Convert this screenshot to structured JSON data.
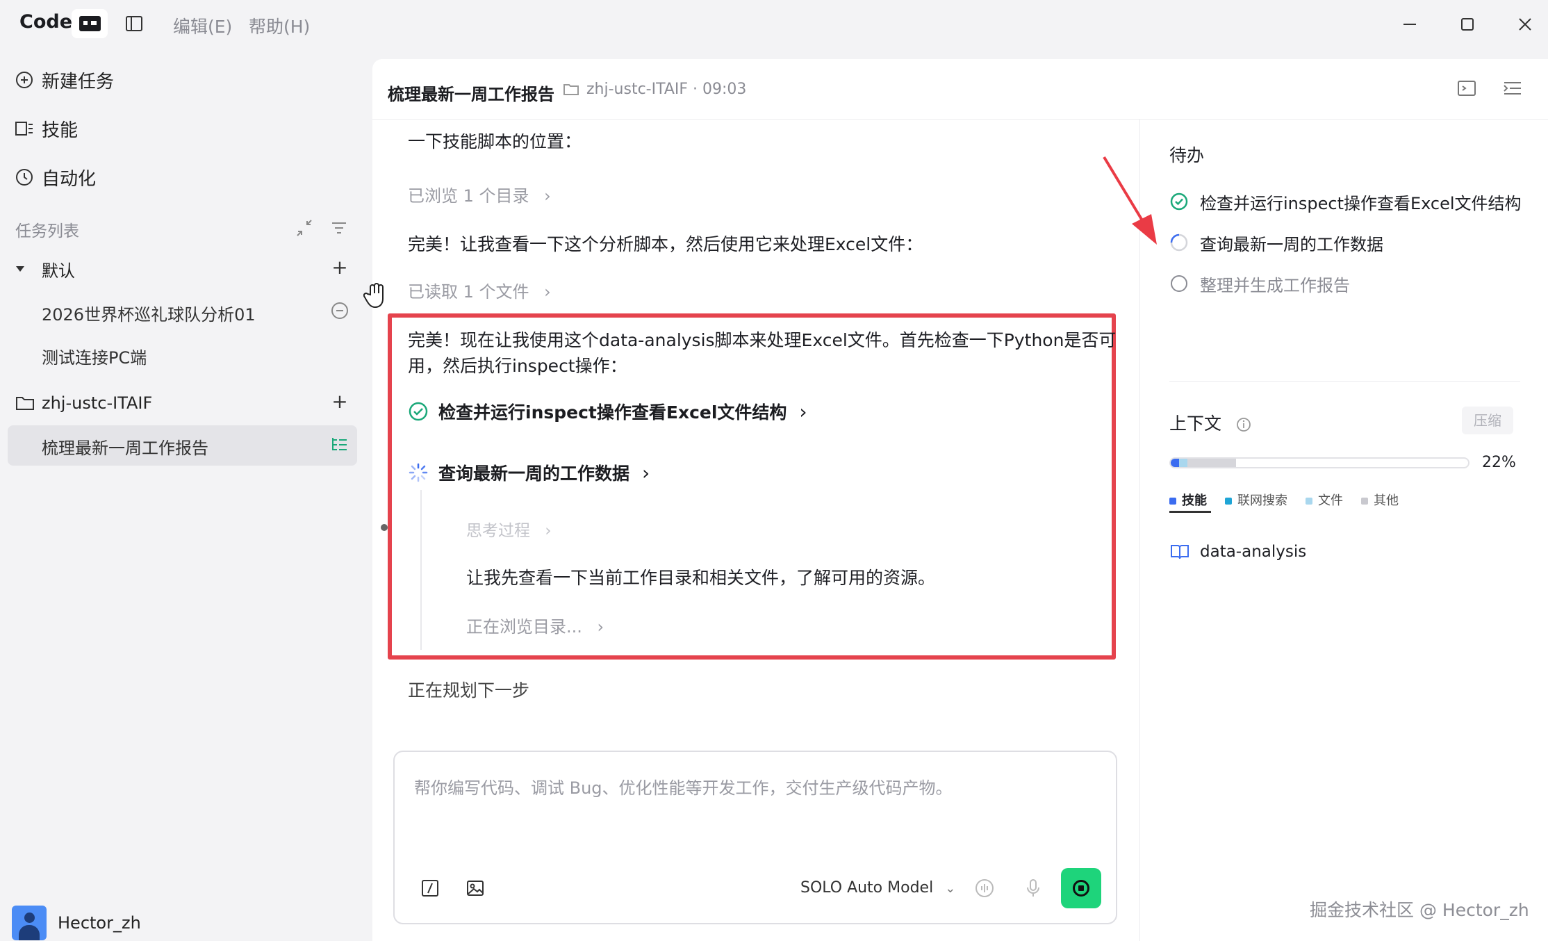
{
  "app": {
    "logo_text": "Code",
    "menu": [
      "编辑(E)",
      "帮助(H)"
    ]
  },
  "sidebar": {
    "nav": [
      {
        "label": "新建任务",
        "icon": "plus-circle-icon"
      },
      {
        "label": "技能",
        "icon": "skills-icon"
      },
      {
        "label": "自动化",
        "icon": "clock-icon"
      }
    ],
    "task_list_label": "任务列表",
    "default_group": {
      "label": "默认",
      "tasks": [
        "2026世界杯巡礼球队分析01",
        "测试连接PC端"
      ]
    },
    "project_group": {
      "label": "zhj-ustc-ITAIF",
      "tasks": [
        "梳理最新一周工作报告"
      ]
    },
    "user": {
      "name": "Hector_zh"
    }
  },
  "header": {
    "title": "梳理最新一周工作报告",
    "meta": "zhj-ustc-ITAIF · 09:03"
  },
  "chat": {
    "cut_line": "一下技能脚本的位置：",
    "browsed": "已浏览 1 个目录",
    "msg1": "完美！让我查看一下这个分析脚本，然后使用它来处理Excel文件：",
    "read": "已读取 1 个文件",
    "msg2_line1": "完美！现在让我使用这个data-analysis脚本来处理Excel文件。首先检查一下Python是否可",
    "msg2_line2": "用，然后执行inspect操作：",
    "step1": "检查并运行inspect操作查看Excel文件结构",
    "step2": "查询最新一周的工作数据",
    "thinking": "思考过程",
    "thought": "让我先查看一下当前工作目录和相关文件，了解可用的资源。",
    "browsing": "正在浏览目录...",
    "planning": "正在规划下一步"
  },
  "input": {
    "placeholder": "帮你编写代码、调试 Bug、优化性能等开发工作，交付生产级代码产物。",
    "model": "SOLO Auto Model"
  },
  "right_panel": {
    "todo_title": "待办",
    "todos": [
      {
        "label": "检查并运行inspect操作查看Excel文件结构",
        "status": "done"
      },
      {
        "label": "查询最新一周的工作数据",
        "status": "in-progress"
      },
      {
        "label": "整理并生成工作报告",
        "status": "pending"
      }
    ],
    "context_title": "上下文",
    "compress": "压缩",
    "usage_percent": "22%",
    "usage_value": 0.22,
    "legend": [
      {
        "label": "技能",
        "color": "#3b6cf0"
      },
      {
        "label": "联网搜索",
        "color": "#1fa5d6"
      },
      {
        "label": "文件",
        "color": "#a9d7ee"
      },
      {
        "label": "其他",
        "color": "#c9c9cf"
      }
    ],
    "skill": "data-analysis"
  },
  "colors": {
    "accent_green": "#1ed47b",
    "highlight_red": "#e5434d",
    "check_green": "#1aa879",
    "progress_blue": "#3b6cf0"
  },
  "watermark": "掘金技术社区 @ Hector_zh"
}
